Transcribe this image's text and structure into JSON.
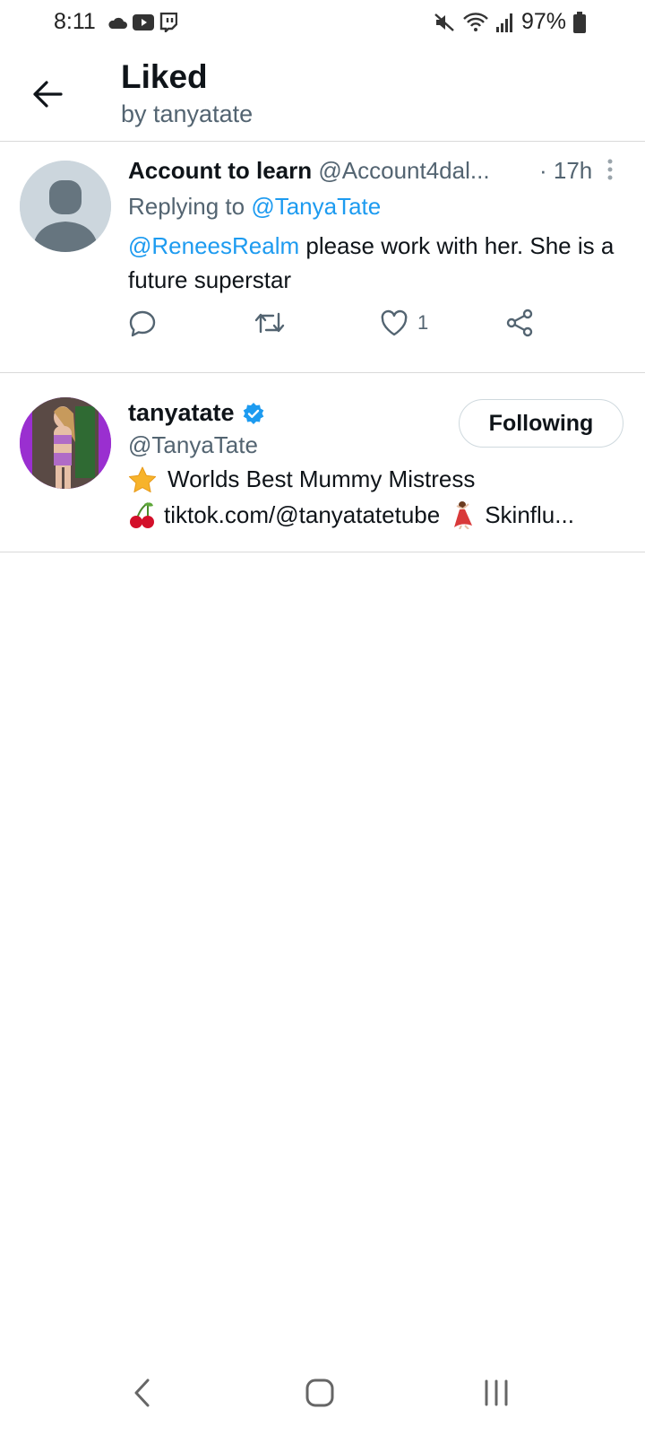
{
  "status": {
    "time": "8:11",
    "battery": "97%"
  },
  "header": {
    "title": "Liked",
    "subtitle": "by tanyatate"
  },
  "tweet": {
    "name": "Account to learn",
    "handle": "@Account4dal...",
    "time": "· 17h",
    "replying_prefix": "Replying to",
    "replying_to": "@TanyaTate",
    "mention": "@ReneesRealm",
    "text": " please work with her. She is a future superstar",
    "like_count": "1"
  },
  "user": {
    "name": "tanyatate",
    "handle": "@TanyaTate",
    "follow_label": "Following",
    "bio_line1": "Worlds Best Mummy Mistress",
    "bio_line2_a": "tiktok.com/@tanyatatetube",
    "bio_line2_b": "Skinflu..."
  },
  "colors": {
    "accent": "#1d9bf0",
    "secondary_text": "#536471",
    "divider": "#d9d9d9",
    "avatar_purple": "#9a2fd0"
  }
}
